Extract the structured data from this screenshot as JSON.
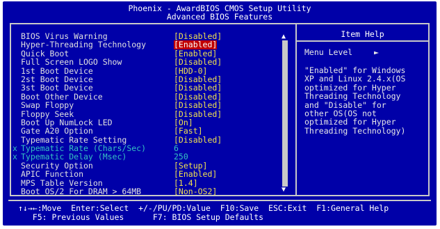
{
  "title": {
    "line1": "Phoenix - AwardBIOS CMOS Setup Utility",
    "line2": "Advanced BIOS Features"
  },
  "settings": [
    {
      "label": "BIOS Virus Warning",
      "value": "[Disabled]",
      "state": "normal"
    },
    {
      "label": "Hyper-Threading Technology",
      "value": "[Enabled]",
      "state": "selected"
    },
    {
      "label": "Quick Boot",
      "value": "[Enabled]",
      "state": "normal"
    },
    {
      "label": "Full Screen LOGO Show",
      "value": "[Disabled]",
      "state": "normal"
    },
    {
      "label": "1st Boot Device",
      "value": "[HDD-0]",
      "state": "normal"
    },
    {
      "label": "2st Boot Device",
      "value": "[Disabled]",
      "state": "normal"
    },
    {
      "label": "3st Boot Device",
      "value": "[Disabled]",
      "state": "normal"
    },
    {
      "label": "Boot Other Device",
      "value": "[Disabled]",
      "state": "normal"
    },
    {
      "label": "Swap Floppy",
      "value": "[Disabled]",
      "state": "normal"
    },
    {
      "label": "Floppy Seek",
      "value": "[Disabled]",
      "state": "normal"
    },
    {
      "label": "Boot Up NumLock LED",
      "value": "[On]",
      "state": "normal"
    },
    {
      "label": "Gate A20 Option",
      "value": "[Fast]",
      "state": "normal"
    },
    {
      "label": "Typematic Rate Setting",
      "value": "[Disabled]",
      "state": "normal"
    },
    {
      "label": "Typematic Rate (Chars/Sec)",
      "value": "6",
      "state": "disabled",
      "mark": "x"
    },
    {
      "label": "Typematic Delay (Msec)",
      "value": "250",
      "state": "disabled",
      "mark": "x"
    },
    {
      "label": "Security Option",
      "value": "[Setup]",
      "state": "normal"
    },
    {
      "label": "APIC Function",
      "value": "[Enabled]",
      "state": "normal"
    },
    {
      "label": "MPS Table Version",
      "value": "[1.4]",
      "state": "normal"
    },
    {
      "label": "Boot OS/2 For DRAM > 64MB",
      "value": "[Non-OS2]",
      "state": "normal"
    }
  ],
  "scrollbar": {
    "up_arrow": "▲",
    "down_arrow": "▼"
  },
  "help": {
    "title": "Item Help",
    "menu_level_label": "Menu Level",
    "menu_level_arrow": "►",
    "text_lines": [
      "\"Enabled\" for Windows",
      "XP and Linux 2.4.x(OS",
      "optimized for Hyper",
      "Threading Technology",
      "and \"Disable\" for",
      "other OS(OS not",
      "optimized for Hyper",
      "Threading Technology)"
    ]
  },
  "footer": {
    "line1": "↑↓→←:Move  Enter:Select  +/-/PU/PD:Value  F10:Save  ESC:Exit  F1:General Help",
    "line2": "   F5: Previous Values      F7: BIOS Setup Defaults"
  },
  "colors": {
    "background": "#0000a8",
    "value": "#f0e050",
    "selected_bg": "#c00000",
    "disabled": "#35c2c2",
    "border": "#c8c8c8"
  }
}
